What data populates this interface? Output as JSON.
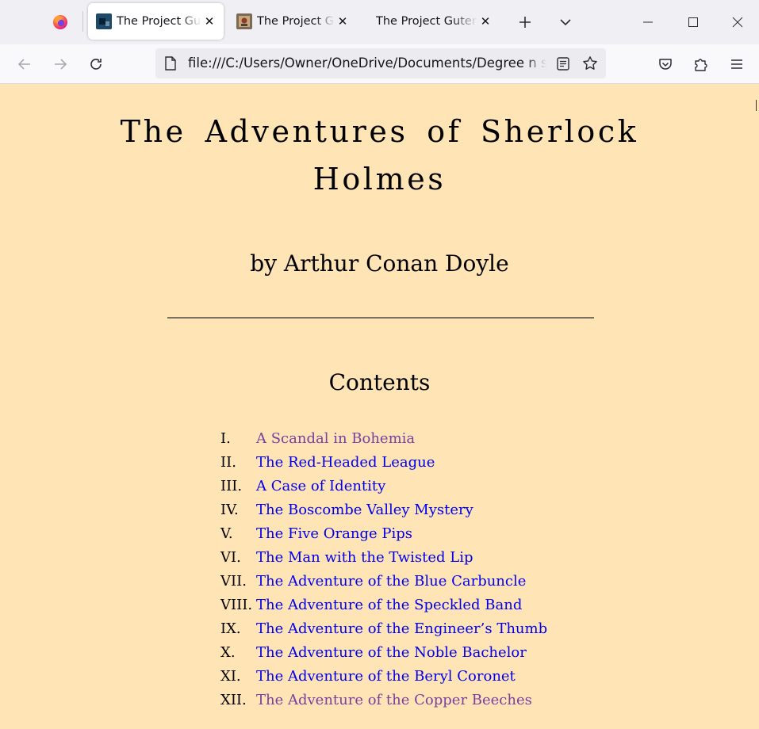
{
  "browser": {
    "tabs": [
      {
        "title": "The Project Gutenberg eBook of The Adventures of Sherlock Holmes",
        "close": "✕",
        "active": true
      },
      {
        "title": "The Project Gutenberg eBook",
        "close": "✕",
        "active": false
      },
      {
        "title": "The Project Gutenberg eBook",
        "close": "✕",
        "active": false
      }
    ],
    "new_tab_icon": "plus-icon",
    "list_tabs_icon": "chevron-down-icon",
    "window_controls": [
      "minimize-icon",
      "maximize-icon",
      "close-icon"
    ],
    "nav": {
      "back_icon": "arrow-left-icon",
      "forward_icon": "arrow-right-icon",
      "reload_icon": "reload-icon",
      "url": "file:///C:/Users/Owner/OneDrive/Documents/Degree n stuff/",
      "page_icon": "document-icon",
      "reader_icon": "reader-view-icon",
      "bookmark_icon": "star-icon",
      "pocket_icon": "pocket-icon",
      "extensions_icon": "puzzle-icon",
      "menu_icon": "hamburger-icon"
    }
  },
  "page": {
    "background": "#ffe4b5",
    "link_color": "#0000ee",
    "visited_color": "#7a3fa0",
    "title_line1": "The Adventures of Sherlock",
    "title_line2": "Holmes",
    "author": "by Arthur Conan Doyle",
    "contents_heading": "Contents",
    "contents": [
      {
        "num": "I.",
        "title": "A Scandal in Bohemia",
        "visited": true
      },
      {
        "num": "II.",
        "title": "The Red-Headed League",
        "visited": false
      },
      {
        "num": "III.",
        "title": "A Case of Identity",
        "visited": false
      },
      {
        "num": "IV.",
        "title": "The Boscombe Valley Mystery",
        "visited": false
      },
      {
        "num": "V.",
        "title": "The Five Orange Pips",
        "visited": false
      },
      {
        "num": "VI.",
        "title": "The Man with the Twisted Lip",
        "visited": false
      },
      {
        "num": "VII.",
        "title": "The Adventure of the Blue Carbuncle",
        "visited": false
      },
      {
        "num": "VIII.",
        "title": "The Adventure of the Speckled Band",
        "visited": false
      },
      {
        "num": "IX.",
        "title": "The Adventure of the Engineer’s Thumb",
        "visited": false
      },
      {
        "num": "X.",
        "title": "The Adventure of the Noble Bachelor",
        "visited": false
      },
      {
        "num": "XI.",
        "title": "The Adventure of the Beryl Coronet",
        "visited": false
      },
      {
        "num": "XII.",
        "title": "The Adventure of the Copper Beeches",
        "visited": true
      }
    ]
  }
}
